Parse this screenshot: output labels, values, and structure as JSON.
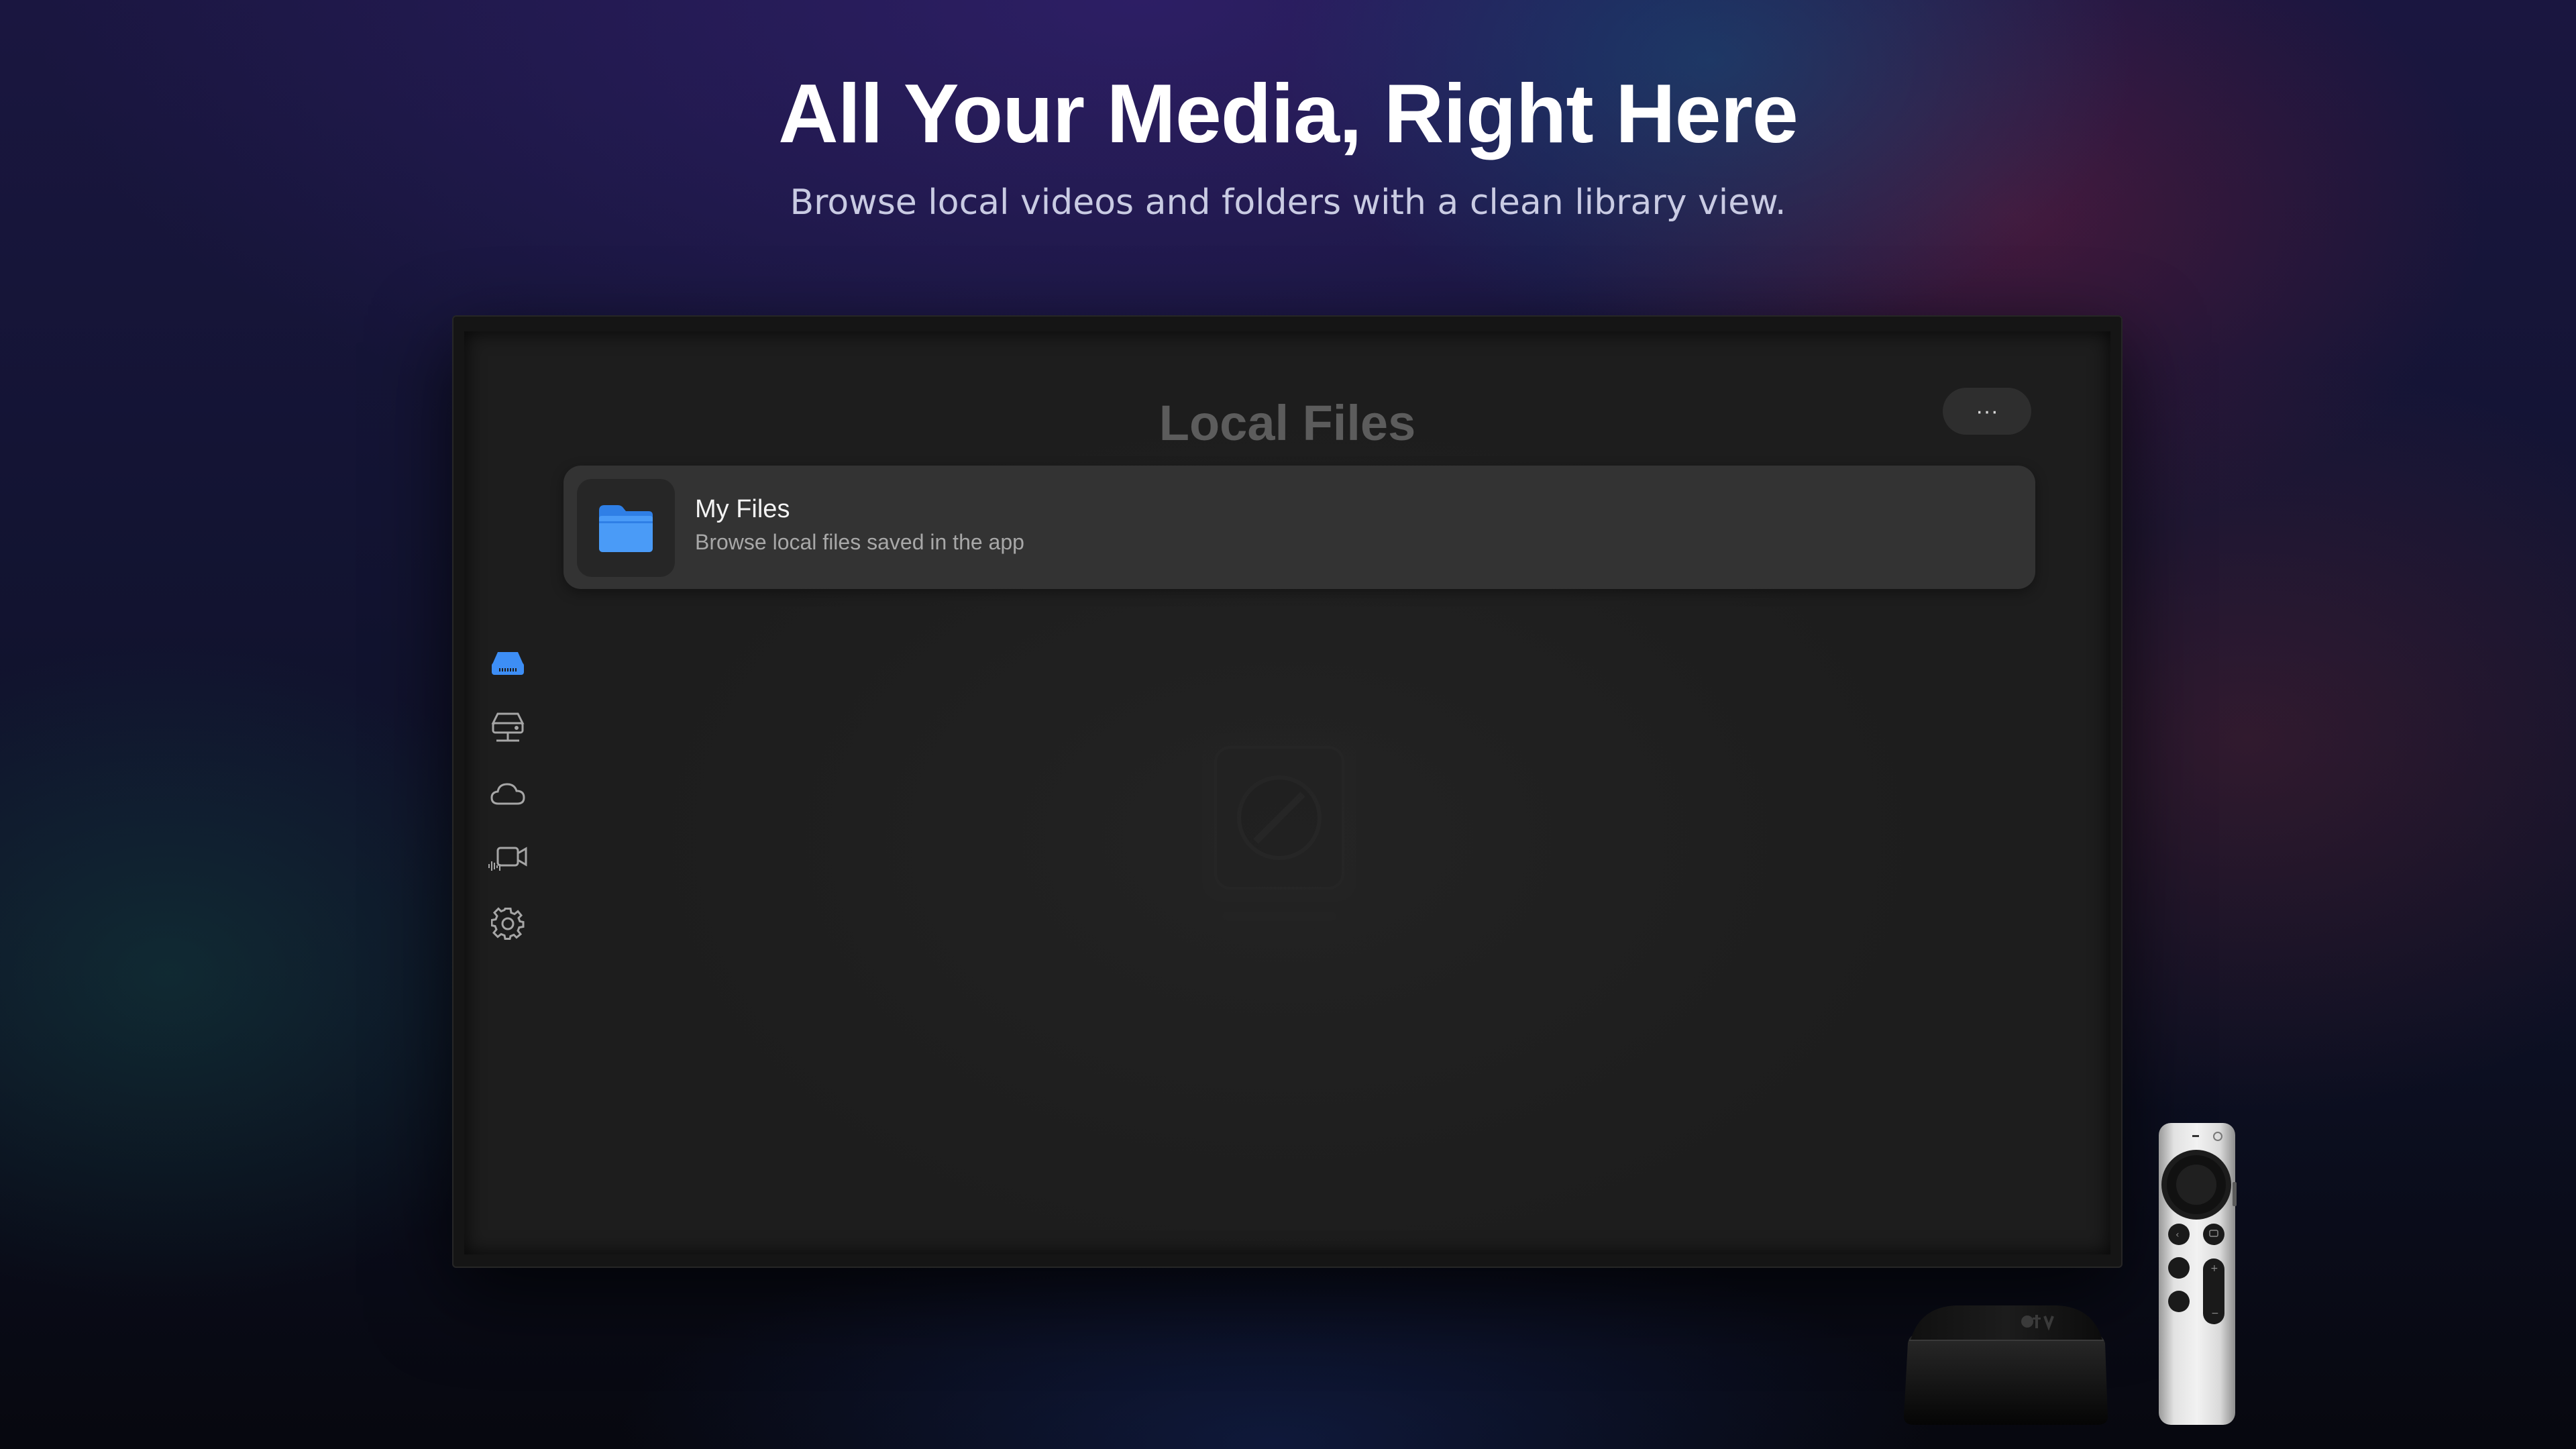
{
  "hero": {
    "title": "All Your Media, Right Here",
    "subtitle": "Browse local videos and folders with a clean library view."
  },
  "screen": {
    "title": "Local Files",
    "more_label": "···",
    "card": {
      "title": "My Files",
      "subtitle": "Browse local files saved in the app",
      "icon": "folder-icon"
    },
    "sidebar": {
      "items": [
        {
          "icon": "local-drive-icon",
          "active": true
        },
        {
          "icon": "network-server-icon",
          "active": false
        },
        {
          "icon": "cloud-icon",
          "active": false
        },
        {
          "icon": "video-camera-icon",
          "active": false
        },
        {
          "icon": "gear-icon",
          "active": false
        }
      ]
    }
  },
  "device": {
    "box_logo": "tv"
  },
  "colors": {
    "accent": "#3d8ef5",
    "icon_inactive": "#a6a6a6"
  }
}
